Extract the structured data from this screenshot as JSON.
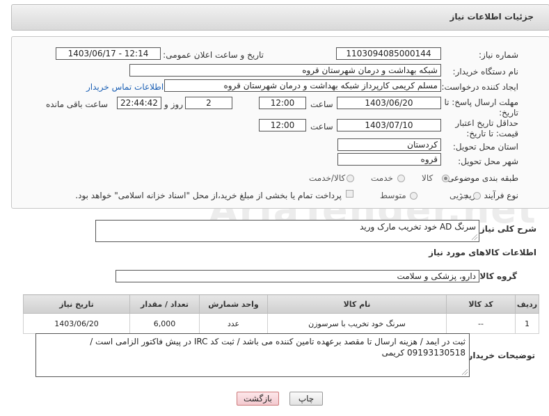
{
  "header": {
    "title": "جزئیات اطلاعات نیاز"
  },
  "form": {
    "need_number": {
      "label": "شماره نیاز:",
      "value": "1103094085000144"
    },
    "announce": {
      "label": "تاریخ و ساعت اعلان عمومی:",
      "value": "1403/06/17 - 12:14"
    },
    "buyer_org": {
      "label": "نام دستگاه خریدار:",
      "value": "شبکه بهداشت و درمان شهرستان قروه"
    },
    "requester": {
      "label": "ایجاد کننده درخواست:",
      "value": "مسلم کریمی کارپرداز شبکه بهداشت و درمان شهرستان قروه",
      "contact_link": "اطلاعات تماس خریدار"
    },
    "reply_deadline": {
      "label": "مهلت ارسال پاسخ: تا تاریخ:",
      "date": "1403/06/20",
      "time_label": "ساعت",
      "time": "12:00",
      "days": "2",
      "days_label": "روز و",
      "remaining": "22:44:42",
      "remaining_label": "ساعت باقی مانده"
    },
    "price_validity": {
      "label": "حداقل تاریخ اعتبار قیمت: تا تاریخ:",
      "date": "1403/07/10",
      "time_label": "ساعت",
      "time": "12:00"
    },
    "province": {
      "label": "استان محل تحویل:",
      "value": "کردستان"
    },
    "city": {
      "label": "شهر محل تحویل:",
      "value": "قروه"
    },
    "category": {
      "label": "طبقه بندی موضوعی:",
      "options": [
        "کالا",
        "خدمت",
        "کالا/خدمت"
      ],
      "selected": "کالا"
    },
    "process": {
      "label": "نوع فرآیند خرید :",
      "options": [
        "جزیی",
        "متوسط"
      ],
      "note": "پرداخت تمام یا بخشی از مبلغ خرید،از محل \"اسناد خزانه اسلامی\" خواهد بود."
    }
  },
  "summary": {
    "label": "شرح کلی نیاز:",
    "value": "سرنگ AD خود تخریب مارک ورید"
  },
  "goods_section_title": "اطلاعات کالاهای مورد نیاز",
  "goods_group": {
    "label": "گروه کالا:",
    "value": "دارو، پزشکی و سلامت"
  },
  "table": {
    "headers": [
      "ردیف",
      "کد کالا",
      "نام کالا",
      "واحد شمارش",
      "تعداد / مقدار",
      "تاریخ نیاز"
    ],
    "rows": [
      [
        "1",
        "--",
        "سرنگ خود تخریب با سرسوزن",
        "عدد",
        "6,000",
        "1403/06/20"
      ]
    ]
  },
  "buyer_notes": {
    "label": "توضیحات خریدار:",
    "value": "ثبت در ایمد / هزینه ارسال تا مقصد برعهده تامین کننده می باشد / ثبت کد IRC  در پیش فاکتور الزامی است / 09193130518 کریمی"
  },
  "buttons": {
    "print": "چاپ",
    "back": "بازگشت"
  },
  "watermark": "AriaTender.net"
}
